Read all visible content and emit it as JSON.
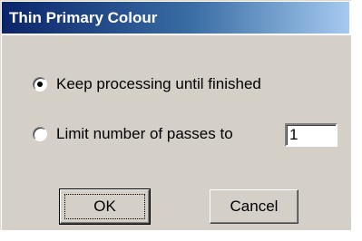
{
  "dialog": {
    "title": "Thin Primary Colour"
  },
  "options": {
    "keep_processing": {
      "label": "Keep processing until finished",
      "selected": true
    },
    "limit_passes": {
      "label": "Limit number of passes to",
      "selected": false,
      "value": "1"
    }
  },
  "buttons": {
    "ok_label": "OK",
    "cancel_label": "Cancel"
  },
  "colors": {
    "title_gradient_start": "#0a246a",
    "title_gradient_end": "#a6caf0",
    "dialog_face": "#d4d0c8"
  }
}
